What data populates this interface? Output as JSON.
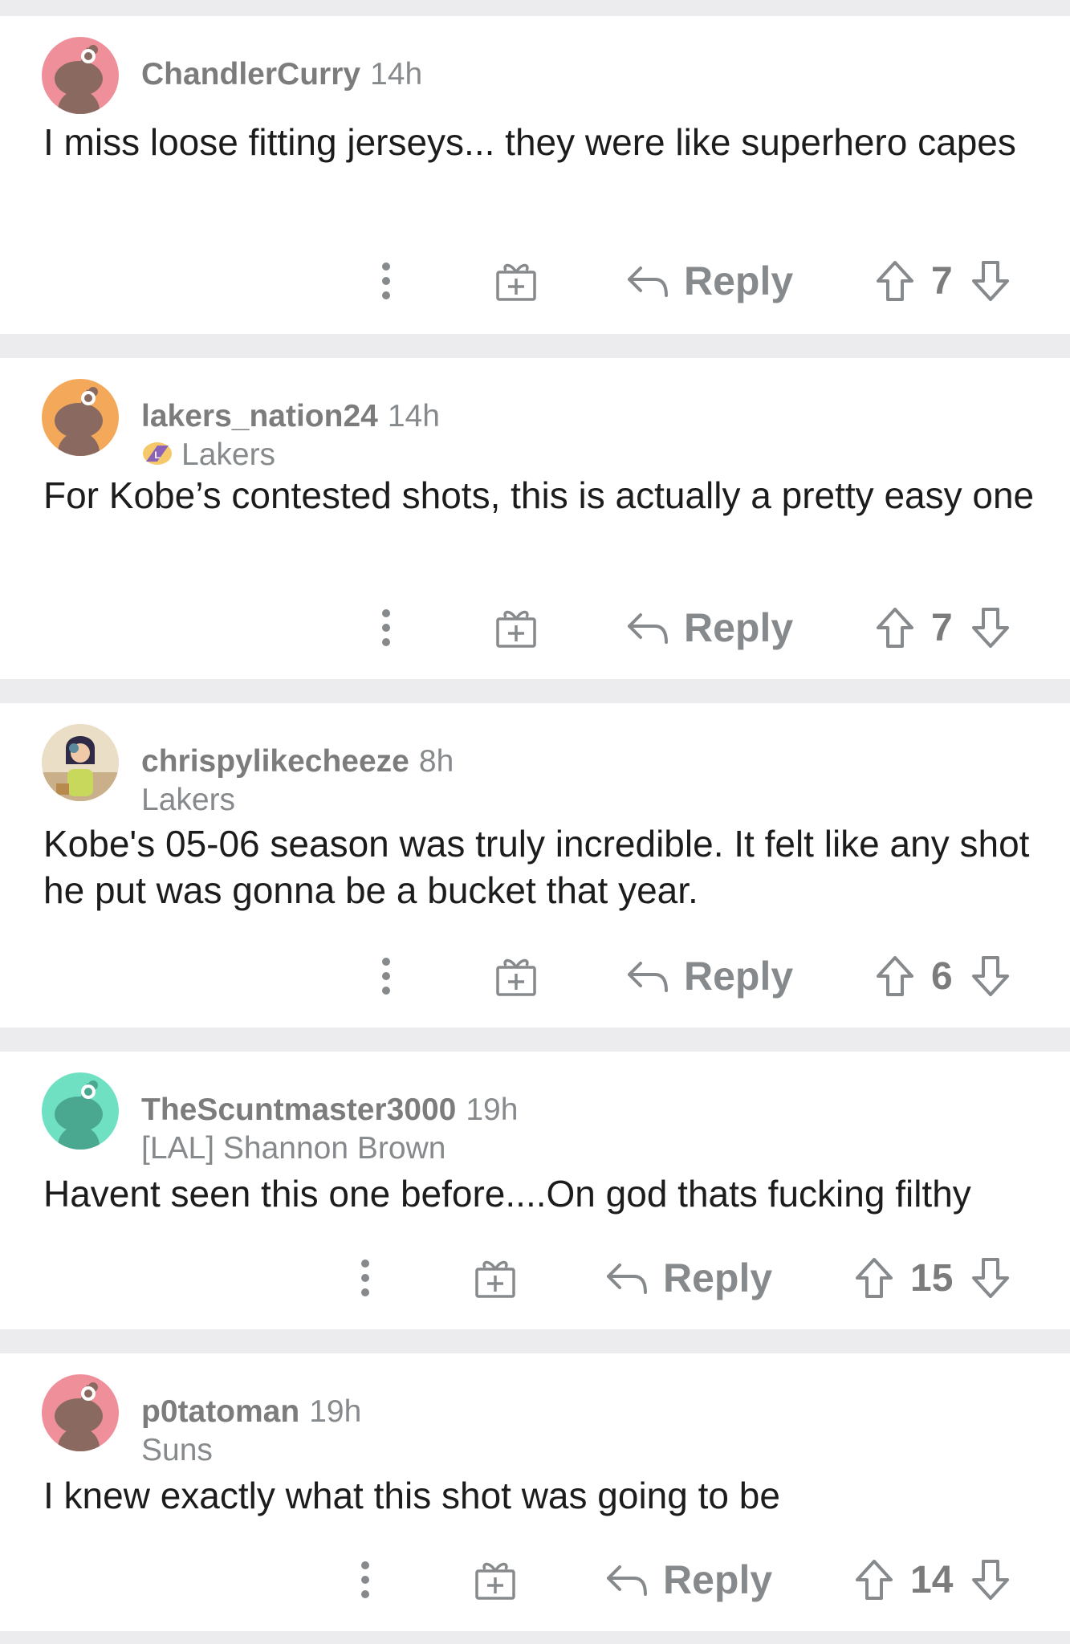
{
  "actions": {
    "reply_label": "Reply"
  },
  "colors": {
    "background": "#ececee",
    "card": "#ffffff",
    "meta_text": "#878a8c",
    "body_text": "#1c1c1c"
  },
  "icons": [
    "more-options-icon",
    "award-gift-icon",
    "reply-arrow-icon",
    "upvote-arrow-icon",
    "downvote-arrow-icon"
  ],
  "comments": [
    {
      "username": "ChandlerCurry",
      "time": "14h",
      "flair": "",
      "avatar_color": "#ef8f9a",
      "body": "I miss loose fitting jerseys... they were like superhero capes",
      "score": "7"
    },
    {
      "username": "lakers_nation24",
      "time": "14h",
      "flair": "Lakers",
      "flair_icon": "lakers-logo-icon",
      "avatar_color": "#f4a95a",
      "body": "For Kobe’s contested shots, this is actually a pretty easy one",
      "score": "7"
    },
    {
      "username": "chrispylikecheeze",
      "time": "8h",
      "flair": "Lakers",
      "avatar_color": "#e8d9b8",
      "body": "Kobe's 05-06 season was truly incredible. It felt like any shot he put was gonna be a bucket that year.",
      "score": "6"
    },
    {
      "username": "TheScuntmaster3000",
      "time": "19h",
      "flair": "[LAL] Shannon Brown",
      "avatar_color": "#6fe0c2",
      "body": "Havent seen this one before....On god thats fucking filthy",
      "score": "15"
    },
    {
      "username": "p0tatoman",
      "time": "19h",
      "flair": "Suns",
      "avatar_color": "#ef8f9a",
      "body": "I knew exactly what this shot was going to be",
      "score": "14"
    }
  ]
}
